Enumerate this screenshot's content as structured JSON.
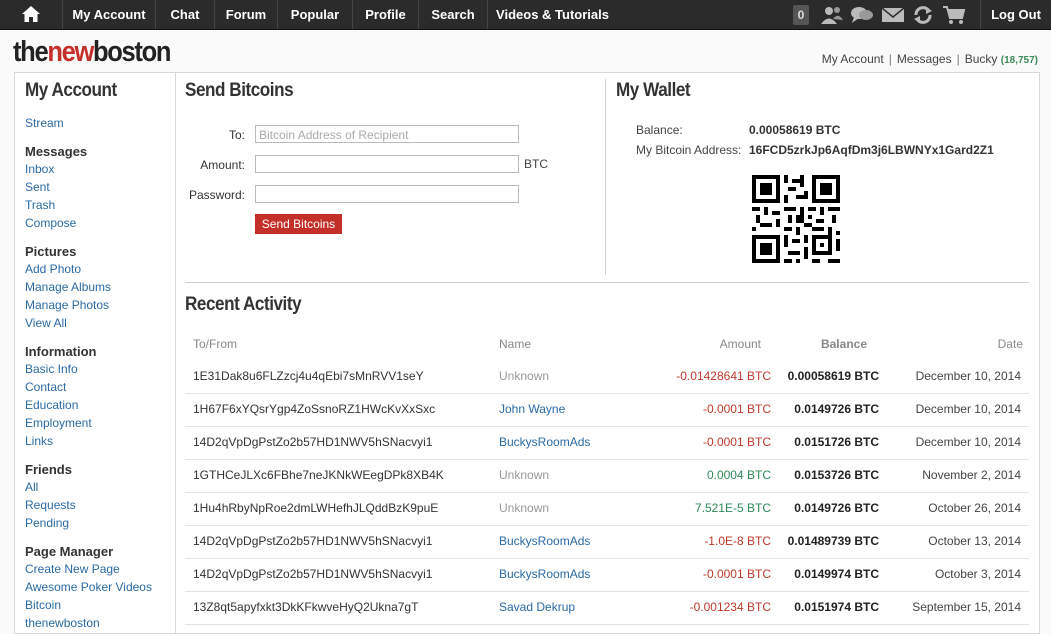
{
  "nav": {
    "items": [
      "My Account",
      "Chat",
      "Forum",
      "Popular",
      "Profile",
      "Search",
      "Videos & Tutorials"
    ],
    "notif_count": "0",
    "logout": "Log Out"
  },
  "logo": {
    "part1": "the",
    "part2": "new",
    "part3": "boston"
  },
  "userlinks": {
    "account": "My Account",
    "messages": "Messages",
    "user": "Bucky",
    "points": "(18,757)"
  },
  "sidebar": {
    "title": "My Account",
    "stream": "Stream",
    "sections": [
      {
        "head": "Messages",
        "links": [
          "Inbox",
          "Sent",
          "Trash",
          "Compose"
        ]
      },
      {
        "head": "Pictures",
        "links": [
          "Add Photo",
          "Manage Albums",
          "Manage Photos",
          "View All"
        ]
      },
      {
        "head": "Information",
        "links": [
          "Basic Info",
          "Contact",
          "Education",
          "Employment",
          "Links"
        ]
      },
      {
        "head": "Friends",
        "links": [
          "All",
          "Requests",
          "Pending"
        ]
      },
      {
        "head": "Page Manager",
        "links": [
          "Create New Page",
          "Awesome Poker Videos",
          "Bitcoin",
          "thenewboston"
        ]
      }
    ]
  },
  "send": {
    "title": "Send Bitcoins",
    "to_label": "To:",
    "to_placeholder": "Bitcoin Address of Recipient",
    "amount_label": "Amount:",
    "amount_unit": "BTC",
    "password_label": "Password:",
    "button": "Send Bitcoins"
  },
  "wallet": {
    "title": "My Wallet",
    "balance_label": "Balance:",
    "balance_value": "0.00058619 BTC",
    "address_label": "My Bitcoin Address:",
    "address_value": "16FCD5zrkJp6AqfDm3j6LBWNYx1Gard2Z1"
  },
  "activity": {
    "title": "Recent Activity",
    "headers": {
      "tofrom": "To/From",
      "name": "Name",
      "amount": "Amount",
      "balance": "Balance",
      "date": "Date"
    },
    "rows": [
      {
        "addr": "1E31Dak8u6FLZzcj4u4qEbi7sMnRVV1seY",
        "name": "Unknown",
        "known": false,
        "amount": "-0.01428641 BTC",
        "sign": "neg",
        "balance": "0.00058619 BTC",
        "date": "December 10, 2014"
      },
      {
        "addr": "1H67F6xYQsrYgp4ZoSsnoRZ1HWcKvXxSxc",
        "name": "John Wayne",
        "known": true,
        "amount": "-0.0001 BTC",
        "sign": "neg",
        "balance": "0.0149726 BTC",
        "date": "December 10, 2014"
      },
      {
        "addr": "14D2qVpDgPstZo2b57HD1NWV5hSNacvyi1",
        "name": "BuckysRoomAds",
        "known": true,
        "amount": "-0.0001 BTC",
        "sign": "neg",
        "balance": "0.0151726 BTC",
        "date": "December 10, 2014"
      },
      {
        "addr": "1GTHCeJLXc6FBhe7neJKNkWEegDPk8XB4K",
        "name": "Unknown",
        "known": false,
        "amount": "0.0004 BTC",
        "sign": "pos",
        "balance": "0.0153726 BTC",
        "date": "November 2, 2014"
      },
      {
        "addr": "1Hu4hRbyNpRoe2dmLWHefhJLQddBzK9puE",
        "name": "Unknown",
        "known": false,
        "amount": "7.521E-5 BTC",
        "sign": "pos",
        "balance": "0.0149726 BTC",
        "date": "October 26, 2014"
      },
      {
        "addr": "14D2qVpDgPstZo2b57HD1NWV5hSNacvyi1",
        "name": "BuckysRoomAds",
        "known": true,
        "amount": "-1.0E-8 BTC",
        "sign": "neg",
        "balance": "0.01489739 BTC",
        "date": "October 13, 2014"
      },
      {
        "addr": "14D2qVpDgPstZo2b57HD1NWV5hSNacvyi1",
        "name": "BuckysRoomAds",
        "known": true,
        "amount": "-0.0001 BTC",
        "sign": "neg",
        "balance": "0.0149974 BTC",
        "date": "October 3, 2014"
      },
      {
        "addr": "13Z8qt5apyfxkt3DkKFkwveHyQ2Ukna7gT",
        "name": "Savad Dekrup",
        "known": true,
        "amount": "-0.001234 BTC",
        "sign": "neg",
        "balance": "0.0151974 BTC",
        "date": "September 15, 2014"
      }
    ]
  }
}
